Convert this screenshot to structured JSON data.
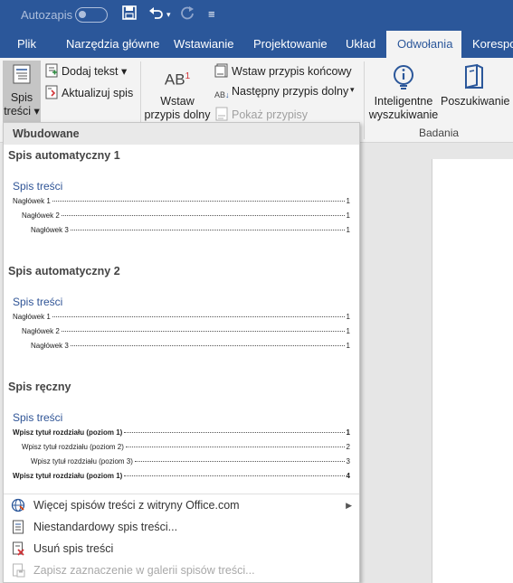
{
  "qat": {
    "autosave_label": "Autozapis",
    "more_glyph": "≡"
  },
  "tabs": [
    {
      "label": "Plik"
    },
    {
      "label": "Narzędzia główne"
    },
    {
      "label": "Wstawianie"
    },
    {
      "label": "Projektowanie"
    },
    {
      "label": "Układ"
    },
    {
      "label": "Odwołania"
    },
    {
      "label": "Korespo"
    }
  ],
  "ribbon": {
    "toc_button": {
      "line1": "Spis",
      "line2": "treści ▾"
    },
    "add_text": "Dodaj tekst ▾",
    "update_toc": "Aktualizuj spis",
    "insert_footnote": {
      "line1": "Wstaw",
      "line2": "przypis dolny"
    },
    "insert_endnote": "Wstaw przypis końcowy",
    "next_footnote": "Następny przypis dolny",
    "next_footnote_arrow": "▾",
    "show_notes": "Pokaż przypisy",
    "smart_lookup": {
      "line1": "Inteligentne",
      "line2": "wyszukiwanie"
    },
    "researcher": "Poszukiwanie",
    "research_group_label": "Badania",
    "footnote_icon_text": "AB",
    "footnote_icon_sup": "1"
  },
  "dropdown": {
    "header": "Wbudowane",
    "sections": [
      {
        "title": "Spis automatyczny 1",
        "toc_title": "Spis treści",
        "lines": [
          {
            "label": "Nagłówek 1",
            "page": "1",
            "level": 1,
            "bold": false
          },
          {
            "label": "Nagłówek 2",
            "page": "1",
            "level": 2,
            "bold": false
          },
          {
            "label": "Nagłówek 3",
            "page": "1",
            "level": 3,
            "bold": false
          }
        ]
      },
      {
        "title": "Spis automatyczny 2",
        "toc_title": "Spis treści",
        "lines": [
          {
            "label": "Nagłówek 1",
            "page": "1",
            "level": 1,
            "bold": false
          },
          {
            "label": "Nagłówek 2",
            "page": "1",
            "level": 2,
            "bold": false
          },
          {
            "label": "Nagłówek 3",
            "page": "1",
            "level": 3,
            "bold": false
          }
        ]
      },
      {
        "title": "Spis ręczny",
        "toc_title": "Spis treści",
        "lines": [
          {
            "label": "Wpisz tytuł rozdziału (poziom 1)",
            "page": "1",
            "level": 1,
            "bold": true
          },
          {
            "label": "Wpisz tytuł rozdziału (poziom 2)",
            "page": "2",
            "level": 2,
            "bold": false
          },
          {
            "label": "Wpisz tytuł rozdziału (poziom 3)",
            "page": "3",
            "level": 3,
            "bold": false
          },
          {
            "label": "Wpisz tytuł rozdziału (poziom 1)",
            "page": "4",
            "level": 1,
            "bold": true
          }
        ]
      }
    ],
    "menu": [
      {
        "label": "Więcej spisów treści z witryny Office.com",
        "disabled": false,
        "submenu": true,
        "icon": "globe-icon"
      },
      {
        "label": "Niestandardowy spis treści...",
        "disabled": false,
        "submenu": false,
        "icon": "document-icon"
      },
      {
        "label": "Usuń spis treści",
        "disabled": false,
        "submenu": false,
        "icon": "remove-document-icon"
      },
      {
        "label": "Zapisz zaznaczenie w galerii spisów treści...",
        "disabled": true,
        "submenu": false,
        "icon": "save-gallery-icon"
      }
    ],
    "submenu_arrow": "▶"
  },
  "colors": {
    "brand": "#2b579a",
    "toc_title": "#2f5496",
    "ribbon_bg": "#f3f3f3"
  }
}
